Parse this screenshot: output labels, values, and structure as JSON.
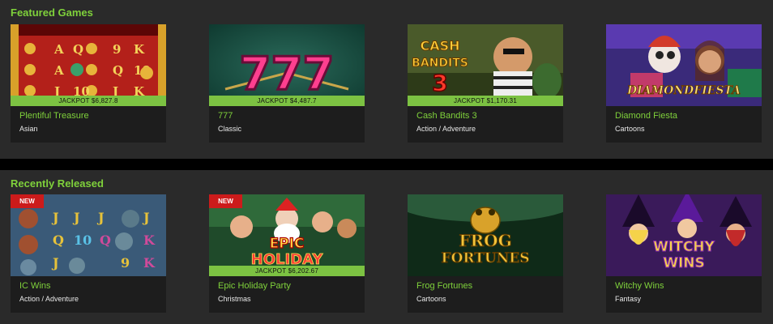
{
  "featured": {
    "title": "Featured Games",
    "games": [
      {
        "name": "Plentiful Treasure",
        "category": "Asian",
        "jackpot": "JACKPOT $6,827.8",
        "badge": ""
      },
      {
        "name": "777",
        "category": "Classic",
        "jackpot": "JACKPOT $4,487.7",
        "badge": "",
        "art_text": "777"
      },
      {
        "name": "Cash Bandits 3",
        "category": "Action / Adventure",
        "jackpot": "JACKPOT $1,170.31",
        "badge": "",
        "art_text": "CASH BANDITS 3"
      },
      {
        "name": "Diamond Fiesta",
        "category": "Cartoons",
        "jackpot": "",
        "badge": "",
        "art_text": "DIAMONDFIESTA"
      }
    ]
  },
  "recent": {
    "title": "Recently Released",
    "games": [
      {
        "name": "IC Wins",
        "category": "Action / Adventure",
        "jackpot": "",
        "badge": "NEW"
      },
      {
        "name": "Epic Holiday Party",
        "category": "Christmas",
        "jackpot": "JACKPOT $6,202.67",
        "badge": "NEW",
        "art_text": "EPIC HOLIDAY"
      },
      {
        "name": "Frog Fortunes",
        "category": "Cartoons",
        "jackpot": "",
        "badge": "",
        "art_text": "FROG FORTUNES"
      },
      {
        "name": "Witchy Wins",
        "category": "Fantasy",
        "jackpot": "",
        "badge": "",
        "art_text": "WITCHY WINS"
      }
    ]
  },
  "colors": {
    "accent": "#7fd13b",
    "jackpot_bar": "#7cc242",
    "badge": "#cc1b1b",
    "panel": "#2a2a2a",
    "card": "#1d1d1d"
  }
}
